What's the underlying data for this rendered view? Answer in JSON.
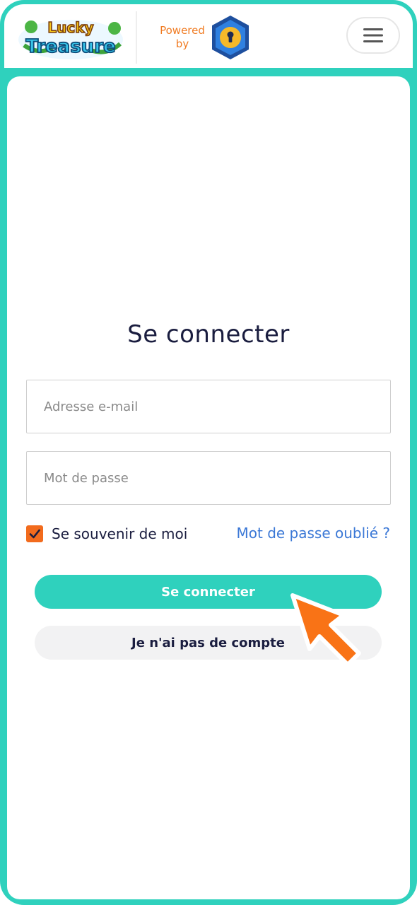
{
  "header": {
    "logo_line1": "Lucky",
    "logo_line2": "Treasure",
    "powered_line1": "Powered",
    "powered_line2": "by",
    "shield_icon": "shield-lock-icon",
    "menu_icon": "hamburger-icon"
  },
  "login": {
    "title": "Se connecter",
    "email_placeholder": "Adresse e-mail",
    "password_placeholder": "Mot de passe",
    "remember_label": "Se souvenir de moi",
    "remember_checked": true,
    "forgot_link": "Mot de passe oublié ?",
    "login_button": "Se connecter",
    "no_account_button": "Je n'ai pas de compte"
  },
  "colors": {
    "frame": "#2fd1bd",
    "accent_orange": "#f26b1d",
    "title_text": "#1a1d3f",
    "link": "#3b78d6"
  }
}
